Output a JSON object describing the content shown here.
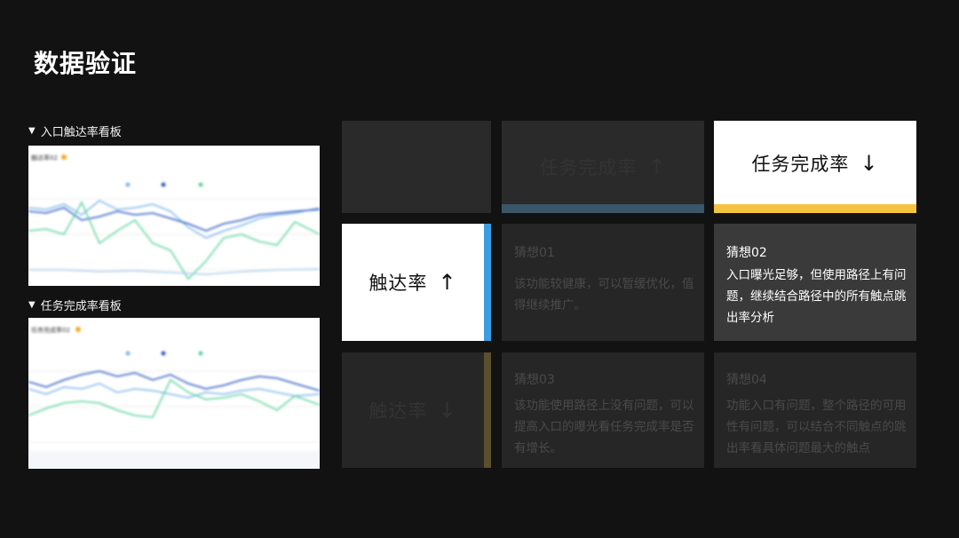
{
  "page": {
    "title": "数据验证"
  },
  "boards": [
    {
      "label": "入口触达率看板",
      "chart_title": "触达率02"
    },
    {
      "label": "任务完成率看板",
      "chart_title": "任务完成率02"
    }
  ],
  "cards": {
    "top_left_empty": "",
    "top_mid_text": "任务完成率",
    "top_mid_arrow": "↑",
    "task_rate_label": "任务完成率",
    "task_rate_arrow": "↓",
    "reach_rate_label": "触达率",
    "reach_rate_arrow": "↑",
    "bottom_left_label": "触达率",
    "bottom_left_arrow": "↓"
  },
  "guesses": [
    {
      "title": "猜想01",
      "body": "该功能较健康，可以暂缓优化，值得继续推广。"
    },
    {
      "title": "猜想02",
      "body": "入口曝光足够，但使用路径上有问题，继续结合路径中的所有触点跳出率分析"
    },
    {
      "title": "猜想03",
      "body": "该功能使用路径上没有问题，可以提高入口的曝光看任务完成率是否有增长。"
    },
    {
      "title": "猜想04",
      "body": "功能入口有问题，整个路径的可用性有问题，可以结合不同触点的跳出率看具体问题最大的触点"
    }
  ],
  "colors": {
    "background": "#121212",
    "card": "#2a2a2a",
    "yellow_accent": "#f5c342",
    "blue_accent": "#3a9ee0",
    "steel_accent": "#3b5668",
    "olive_accent": "#5c4f2e"
  }
}
